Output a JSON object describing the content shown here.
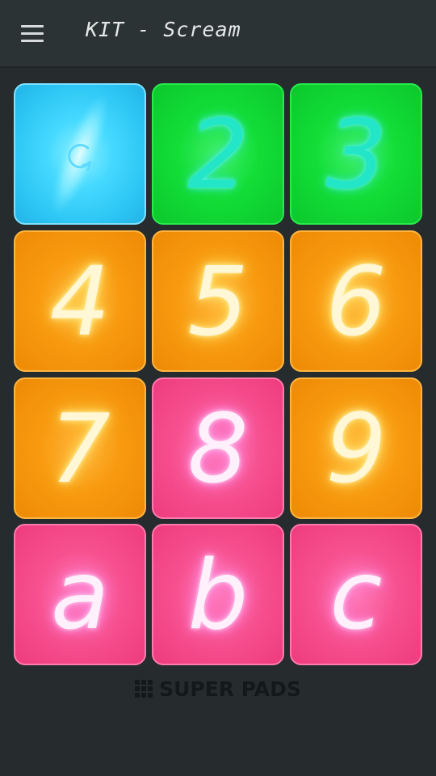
{
  "app_bar": {
    "title": "KIT - Scream",
    "menu_icon": "hamburger-menu-icon"
  },
  "pads": [
    {
      "label": "",
      "color": "blue",
      "icon": "refresh-icon"
    },
    {
      "label": "2",
      "color": "green"
    },
    {
      "label": "3",
      "color": "green"
    },
    {
      "label": "4",
      "color": "orange"
    },
    {
      "label": "5",
      "color": "orange"
    },
    {
      "label": "6",
      "color": "orange"
    },
    {
      "label": "7",
      "color": "orange"
    },
    {
      "label": "8",
      "color": "pink"
    },
    {
      "label": "9",
      "color": "orange"
    },
    {
      "label": "a",
      "color": "pink"
    },
    {
      "label": "b",
      "color": "pink"
    },
    {
      "label": "c",
      "color": "pink"
    }
  ],
  "footer": {
    "label": "SUPER PADS",
    "icon": "grid-icon"
  },
  "colors": {
    "background": "#262b2d",
    "app_bar": "#2c3335",
    "blue": "#2bc4f3",
    "green": "#12dd37",
    "orange": "#f89a10",
    "pink": "#f7518f"
  }
}
